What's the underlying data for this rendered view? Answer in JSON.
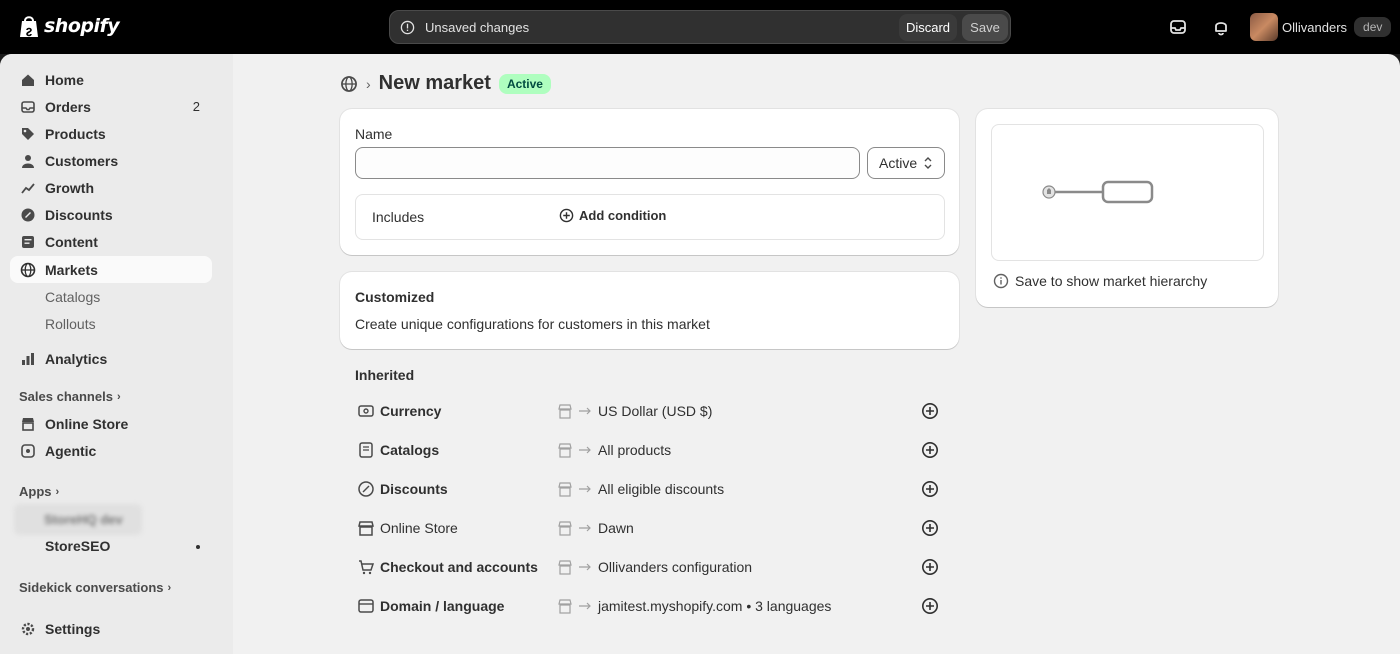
{
  "topbar": {
    "logo_text": "shopify",
    "savebar_message": "Unsaved changes",
    "discard_label": "Discard",
    "save_label": "Save",
    "store_name": "Ollivanders",
    "store_badge": "dev"
  },
  "sidebar": {
    "items": [
      {
        "label": "Home",
        "icon": "home-icon"
      },
      {
        "label": "Orders",
        "icon": "orders-icon",
        "badge": "2"
      },
      {
        "label": "Products",
        "icon": "tag-icon"
      },
      {
        "label": "Customers",
        "icon": "person-icon"
      },
      {
        "label": "Growth",
        "icon": "growth-icon"
      },
      {
        "label": "Discounts",
        "icon": "discount-icon"
      },
      {
        "label": "Content",
        "icon": "content-icon"
      },
      {
        "label": "Markets",
        "icon": "globe-icon"
      },
      {
        "label": "Catalogs"
      },
      {
        "label": "Rollouts"
      },
      {
        "label": "Analytics",
        "icon": "analytics-icon"
      }
    ],
    "sales_channels_label": "Sales channels",
    "channels": [
      {
        "label": "Online Store",
        "icon": "store-icon"
      },
      {
        "label": "Agentic",
        "icon": "agentic-icon"
      }
    ],
    "apps_label": "Apps",
    "apps": [
      {
        "label": "StoreHQ dev"
      },
      {
        "label": "StoreSEO"
      }
    ],
    "sidekick_label": "Sidekick conversations",
    "settings_label": "Settings"
  },
  "page": {
    "title": "New market",
    "status_badge": "Active",
    "name_label": "Name",
    "name_value": "",
    "status_value": "Active",
    "includes_label": "Includes",
    "add_condition_label": "Add condition",
    "customized_title": "Customized",
    "customized_desc": "Create unique configurations for customers in this market",
    "inherited_title": "Inherited",
    "inherited": [
      {
        "key": "Currency",
        "value": "US Dollar (USD $)",
        "icon": "currency-icon"
      },
      {
        "key": "Catalogs",
        "value": "All products",
        "icon": "catalog-icon"
      },
      {
        "key": "Discounts",
        "value": "All eligible discounts",
        "icon": "discount-icon"
      },
      {
        "key": "Online Store",
        "value": "Dawn",
        "icon": "store-icon"
      },
      {
        "key": "Checkout and accounts",
        "value": "Ollivanders configuration",
        "icon": "checkout-icon"
      },
      {
        "key": "Domain / language",
        "value": "jamitest.myshopify.com • 3 languages",
        "icon": "globe-icon"
      }
    ],
    "hierarchy_hint": "Save to show market hierarchy"
  },
  "colors": {
    "active_badge_bg": "#affebf",
    "active_badge_text": "#014b40",
    "topbar_bg": "#000000"
  }
}
